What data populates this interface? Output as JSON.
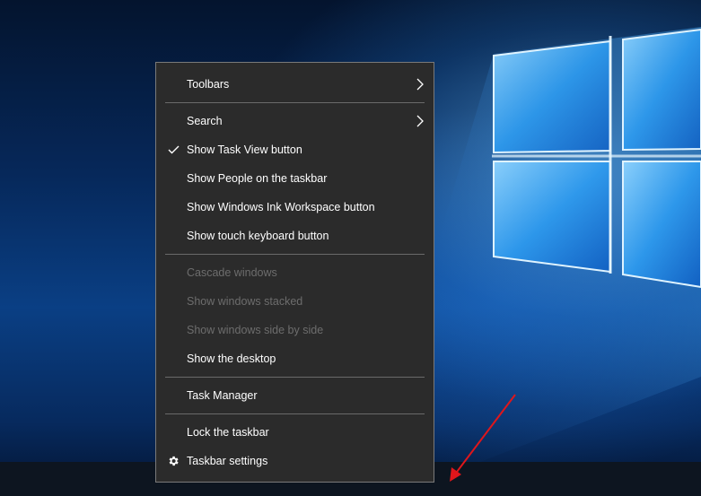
{
  "context_menu": {
    "items": [
      {
        "label": "Toolbars",
        "enabled": true,
        "submenu": true
      },
      {
        "label": "Search",
        "enabled": true,
        "submenu": true
      },
      {
        "label": "Show Task View button",
        "enabled": true,
        "checked": true
      },
      {
        "label": "Show People on the taskbar",
        "enabled": true
      },
      {
        "label": "Show Windows Ink Workspace button",
        "enabled": true
      },
      {
        "label": "Show touch keyboard button",
        "enabled": true
      },
      {
        "label": "Cascade windows",
        "enabled": false
      },
      {
        "label": "Show windows stacked",
        "enabled": false
      },
      {
        "label": "Show windows side by side",
        "enabled": false
      },
      {
        "label": "Show the desktop",
        "enabled": true
      },
      {
        "label": "Task Manager",
        "enabled": true
      },
      {
        "label": "Lock the taskbar",
        "enabled": true
      },
      {
        "label": "Taskbar settings",
        "enabled": true,
        "icon": "gear-icon"
      }
    ]
  },
  "colors": {
    "menu_background": "#2b2b2b",
    "menu_border": "#7a7a7a",
    "enabled_text": "#ffffff",
    "disabled_text": "#6d6d6d",
    "annotation_arrow": "#e0161b"
  }
}
